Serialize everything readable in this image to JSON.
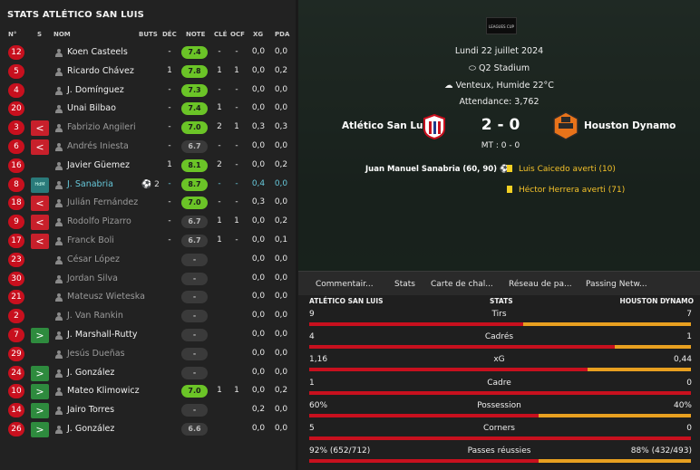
{
  "left": {
    "title": "STATS ATLÉTICO SAN LUIS",
    "headers": {
      "num": "N°",
      "s": "S",
      "nom": "NOM",
      "buts": "BUTS",
      "dec": "DÉC",
      "note": "NOTE",
      "cle": "CLÉ",
      "ocf": "OCF",
      "xg": "XG",
      "pda": "PDA"
    },
    "players": [
      {
        "num": "12",
        "sub": "",
        "name": "Koen Casteels",
        "buts": "",
        "dec": "-",
        "note": "7.4",
        "cle": "-",
        "ocf": "-",
        "xg": "0,0",
        "pda": "0,0",
        "dim": false
      },
      {
        "num": "5",
        "sub": "",
        "name": "Ricardo Chávez",
        "buts": "",
        "dec": "1",
        "note": "7.8",
        "cle": "1",
        "ocf": "1",
        "xg": "0,0",
        "pda": "0,2",
        "dim": false
      },
      {
        "num": "4",
        "sub": "",
        "name": "J. Domínguez",
        "buts": "",
        "dec": "-",
        "note": "7.3",
        "cle": "-",
        "ocf": "-",
        "xg": "0,0",
        "pda": "0,0",
        "dim": false
      },
      {
        "num": "20",
        "sub": "",
        "name": "Unai Bilbao",
        "buts": "",
        "dec": "-",
        "note": "7.4",
        "cle": "1",
        "ocf": "-",
        "xg": "0,0",
        "pda": "0,0",
        "dim": false
      },
      {
        "num": "3",
        "sub": "out",
        "name": "Fabrizio Angileri",
        "buts": "",
        "dec": "-",
        "note": "7.0",
        "cle": "2",
        "ocf": "1",
        "xg": "0,3",
        "pda": "0,3",
        "dim": true
      },
      {
        "num": "6",
        "sub": "out",
        "name": "Andrés Iniesta",
        "buts": "",
        "dec": "-",
        "note": "6.7",
        "cle": "-",
        "ocf": "-",
        "xg": "0,0",
        "pda": "0,0",
        "dim": true
      },
      {
        "num": "16",
        "sub": "",
        "name": "Javier Güemez",
        "buts": "",
        "dec": "1",
        "note": "8.1",
        "cle": "2",
        "ocf": "-",
        "xg": "0,0",
        "pda": "0,2",
        "dim": false
      },
      {
        "num": "8",
        "sub": "hdm",
        "name": "J. Sanabria",
        "buts": "2",
        "dec": "-",
        "note": "8.7",
        "cle": "-",
        "ocf": "-",
        "xg": "0,4",
        "pda": "0,0",
        "dim": false,
        "hl": true
      },
      {
        "num": "18",
        "sub": "out",
        "name": "Julián Fernández",
        "buts": "",
        "dec": "-",
        "note": "7.0",
        "cle": "-",
        "ocf": "-",
        "xg": "0,3",
        "pda": "0,0",
        "dim": true
      },
      {
        "num": "9",
        "sub": "out",
        "name": "Rodolfo Pizarro",
        "buts": "",
        "dec": "-",
        "note": "6.7",
        "cle": "1",
        "ocf": "1",
        "xg": "0,0",
        "pda": "0,2",
        "dim": true
      },
      {
        "num": "17",
        "sub": "out",
        "name": "Franck Boli",
        "buts": "",
        "dec": "-",
        "note": "6.7",
        "cle": "1",
        "ocf": "-",
        "xg": "0,0",
        "pda": "0,1",
        "dim": true
      },
      {
        "num": "23",
        "sub": "",
        "name": "César López",
        "buts": "",
        "dec": "",
        "note": "-",
        "cle": "",
        "ocf": "",
        "xg": "0,0",
        "pda": "0,0",
        "dim": true
      },
      {
        "num": "30",
        "sub": "",
        "name": "Jordan Silva",
        "buts": "",
        "dec": "",
        "note": "-",
        "cle": "",
        "ocf": "",
        "xg": "0,0",
        "pda": "0,0",
        "dim": true
      },
      {
        "num": "21",
        "sub": "",
        "name": "Mateusz Wieteska",
        "buts": "",
        "dec": "",
        "note": "-",
        "cle": "",
        "ocf": "",
        "xg": "0,0",
        "pda": "0,0",
        "dim": true
      },
      {
        "num": "2",
        "sub": "",
        "name": "J. Van Rankin",
        "buts": "",
        "dec": "",
        "note": "-",
        "cle": "",
        "ocf": "",
        "xg": "0,0",
        "pda": "0,0",
        "dim": true
      },
      {
        "num": "7",
        "sub": "in",
        "name": "J. Marshall-Rutty",
        "buts": "",
        "dec": "",
        "note": "-",
        "cle": "",
        "ocf": "",
        "xg": "0,0",
        "pda": "0,0",
        "dim": false
      },
      {
        "num": "29",
        "sub": "",
        "name": "Jesús Dueñas",
        "buts": "",
        "dec": "",
        "note": "-",
        "cle": "",
        "ocf": "",
        "xg": "0,0",
        "pda": "0,0",
        "dim": true
      },
      {
        "num": "24",
        "sub": "in",
        "name": "J. González",
        "buts": "",
        "dec": "",
        "note": "-",
        "cle": "",
        "ocf": "",
        "xg": "0,0",
        "pda": "0,0",
        "dim": false
      },
      {
        "num": "10",
        "sub": "in",
        "name": "Mateo Klimowicz",
        "buts": "",
        "dec": "",
        "note": "7.0",
        "cle": "1",
        "ocf": "1",
        "xg": "0,0",
        "pda": "0,2",
        "dim": false
      },
      {
        "num": "14",
        "sub": "in",
        "name": "Jairo Torres",
        "buts": "",
        "dec": "",
        "note": "-",
        "cle": "",
        "ocf": "",
        "xg": "0,2",
        "pda": "0,0",
        "dim": false
      },
      {
        "num": "26",
        "sub": "in",
        "name": "J. González",
        "buts": "",
        "dec": "",
        "note": "6.6",
        "cle": "",
        "ocf": "",
        "xg": "0,0",
        "pda": "0,0",
        "dim": false
      }
    ]
  },
  "match": {
    "league_logo": "LEAGUES CUP",
    "date": "Lundi 22 juillet 2024",
    "stadium": "Q2 Stadium",
    "weather": "Venteux, Humide 22°C",
    "attendance": "Attendance:  3,762",
    "home": "Atlético San Luis",
    "away": "Houston Dynamo",
    "score": "2 - 0",
    "halftime": "MT : 0 - 0",
    "scorer": "Juan Manuel Sanabria (60, 90)",
    "cards": [
      "Luis Caicedo averti (10)",
      "Héctor Herrera averti (71)"
    ]
  },
  "tabs": [
    "Commentair...",
    "Stats",
    "Carte de chal...",
    "Réseau de pa...",
    "Passing Netw..."
  ],
  "stats": {
    "home_label": "ATLÉTICO SAN LUIS",
    "center_label": "STATS",
    "away_label": "HOUSTON DYNAMO",
    "rows": [
      {
        "label": "Tirs",
        "home": "9",
        "away": "7",
        "home_share": 0.56
      },
      {
        "label": "Cadrés",
        "home": "4",
        "away": "1",
        "home_share": 0.8
      },
      {
        "label": "xG",
        "home": "1,16",
        "away": "0,44",
        "home_share": 0.73
      },
      {
        "label": "Cadre",
        "home": "1",
        "away": "0",
        "home_share": 1.0
      },
      {
        "label": "Possession",
        "home": "60%",
        "away": "40%",
        "home_share": 0.6
      },
      {
        "label": "Corners",
        "home": "5",
        "away": "0",
        "home_share": 1.0
      },
      {
        "label": "Passes réussies",
        "home": "92% (652/712)",
        "away": "88% (432/493)",
        "home_share": 0.6
      }
    ]
  },
  "colors": {
    "home": "#c8101e",
    "away": "#e8a020",
    "note_good": "#6bc427"
  }
}
